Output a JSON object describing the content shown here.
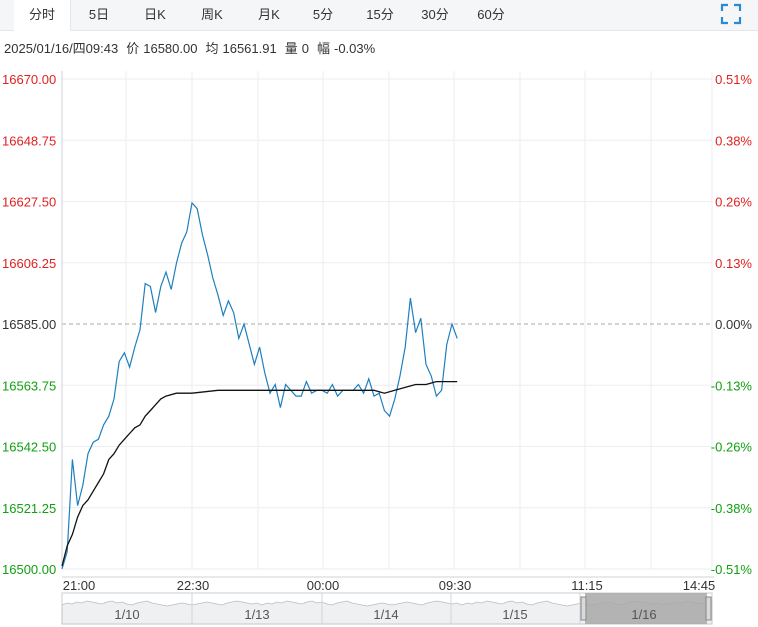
{
  "tabs": [
    {
      "label": "分时",
      "active": true
    },
    {
      "label": "5日"
    },
    {
      "label": "日K"
    },
    {
      "label": "周K"
    },
    {
      "label": "月K"
    },
    {
      "label": "5分"
    },
    {
      "label": "15分"
    },
    {
      "label": "30分"
    },
    {
      "label": "60分"
    }
  ],
  "info": {
    "datetime": "2025/01/16/四09:43",
    "price_label": "价",
    "price": "16580.00",
    "avg_label": "均",
    "avg": "16561.91",
    "vol_label": "量",
    "vol": "0",
    "chg_label": "幅",
    "chg": "-0.03%"
  },
  "colors": {
    "price_line": "#1f7fbf",
    "avg_line": "#111111",
    "up": "#e02020",
    "down": "#10a010",
    "grid": "#eceef1",
    "ref_line": "#aaaaaa",
    "navigator_fill": "#a8a8a8"
  },
  "chart_data": {
    "type": "line",
    "ref_price": 16585.0,
    "y_ticks": [
      "16670.00",
      "16648.75",
      "16627.50",
      "16606.25",
      "16585.00",
      "16563.75",
      "16542.50",
      "16521.25",
      "16500.00"
    ],
    "pct_ticks": [
      "0.51%",
      "0.38%",
      "0.26%",
      "0.13%",
      "0.00%",
      "-0.13%",
      "-0.26%",
      "-0.38%",
      "-0.51%"
    ],
    "ylim": [
      16500.0,
      16670.0
    ],
    "x_ticks": [
      "21:00",
      "22:30",
      "00:00",
      "09:30",
      "11:15",
      "14:45"
    ],
    "series": [
      {
        "key": "price",
        "points": [
          [
            0,
            16500
          ],
          [
            1,
            16506
          ],
          [
            2,
            16538
          ],
          [
            3,
            16522
          ],
          [
            4,
            16529
          ],
          [
            5,
            16540
          ],
          [
            6,
            16544
          ],
          [
            7,
            16545
          ],
          [
            8,
            16550
          ],
          [
            9,
            16553
          ],
          [
            10,
            16559
          ],
          [
            11,
            16572
          ],
          [
            12,
            16575
          ],
          [
            13,
            16570
          ],
          [
            14,
            16577
          ],
          [
            15,
            16583
          ],
          [
            16,
            16599
          ],
          [
            17,
            16598
          ],
          [
            18,
            16589
          ],
          [
            19,
            16598
          ],
          [
            20,
            16603
          ],
          [
            21,
            16597
          ],
          [
            22,
            16606
          ],
          [
            23,
            16613
          ],
          [
            24,
            16617
          ],
          [
            25,
            16627
          ],
          [
            26,
            16625
          ],
          [
            27,
            16616
          ],
          [
            28,
            16609
          ],
          [
            29,
            16601
          ],
          [
            30,
            16595
          ],
          [
            31,
            16588
          ],
          [
            32,
            16593
          ],
          [
            33,
            16589
          ],
          [
            34,
            16580
          ],
          [
            35,
            16585
          ],
          [
            36,
            16578
          ],
          [
            37,
            16571
          ],
          [
            38,
            16577
          ],
          [
            39,
            16568
          ],
          [
            40,
            16561
          ],
          [
            41,
            16564
          ],
          [
            42,
            16556
          ],
          [
            43,
            16564
          ],
          [
            44,
            16562
          ],
          [
            45,
            16560
          ],
          [
            46,
            16560
          ],
          [
            47,
            16565
          ],
          [
            48,
            16561
          ],
          [
            49,
            16562
          ],
          [
            50,
            16562
          ],
          [
            51,
            16561
          ],
          [
            52,
            16564
          ],
          [
            53,
            16560
          ],
          [
            54,
            16562
          ],
          [
            55,
            16562
          ],
          [
            56,
            16562
          ],
          [
            57,
            16564
          ],
          [
            58,
            16561
          ],
          [
            59,
            16566
          ],
          [
            60,
            16560
          ],
          [
            61,
            16561
          ],
          [
            62,
            16555
          ],
          [
            63,
            16553
          ],
          [
            64,
            16559
          ],
          [
            65,
            16567
          ],
          [
            66,
            16577
          ],
          [
            67,
            16594
          ],
          [
            68,
            16582
          ],
          [
            69,
            16587
          ],
          [
            70,
            16571
          ],
          [
            71,
            16567
          ],
          [
            72,
            16560
          ],
          [
            73,
            16562
          ],
          [
            74,
            16578
          ],
          [
            75,
            16585
          ],
          [
            76,
            16580
          ]
        ]
      },
      {
        "key": "avg",
        "points": [
          [
            0,
            16501
          ],
          [
            1,
            16508
          ],
          [
            2,
            16512
          ],
          [
            3,
            16518
          ],
          [
            4,
            16522
          ],
          [
            5,
            16524
          ],
          [
            6,
            16527
          ],
          [
            7,
            16530
          ],
          [
            8,
            16533
          ],
          [
            9,
            16538
          ],
          [
            10,
            16540
          ],
          [
            11,
            16543
          ],
          [
            12,
            16545
          ],
          [
            13,
            16547
          ],
          [
            14,
            16549
          ],
          [
            15,
            16550
          ],
          [
            16,
            16553
          ],
          [
            17,
            16555
          ],
          [
            18,
            16557
          ],
          [
            19,
            16559
          ],
          [
            20,
            16560
          ],
          [
            22,
            16561
          ],
          [
            25,
            16561
          ],
          [
            30,
            16562
          ],
          [
            35,
            16562
          ],
          [
            40,
            16562
          ],
          [
            45,
            16562
          ],
          [
            50,
            16562
          ],
          [
            55,
            16562
          ],
          [
            60,
            16562
          ],
          [
            62,
            16561
          ],
          [
            64,
            16562
          ],
          [
            66,
            16563
          ],
          [
            68,
            16564
          ],
          [
            70,
            16564
          ],
          [
            72,
            16565
          ],
          [
            74,
            16565
          ],
          [
            76,
            16565
          ]
        ]
      }
    ],
    "navigator": {
      "labels": [
        "1/10",
        "1/13",
        "1/14",
        "1/15",
        "1/16"
      ]
    }
  }
}
